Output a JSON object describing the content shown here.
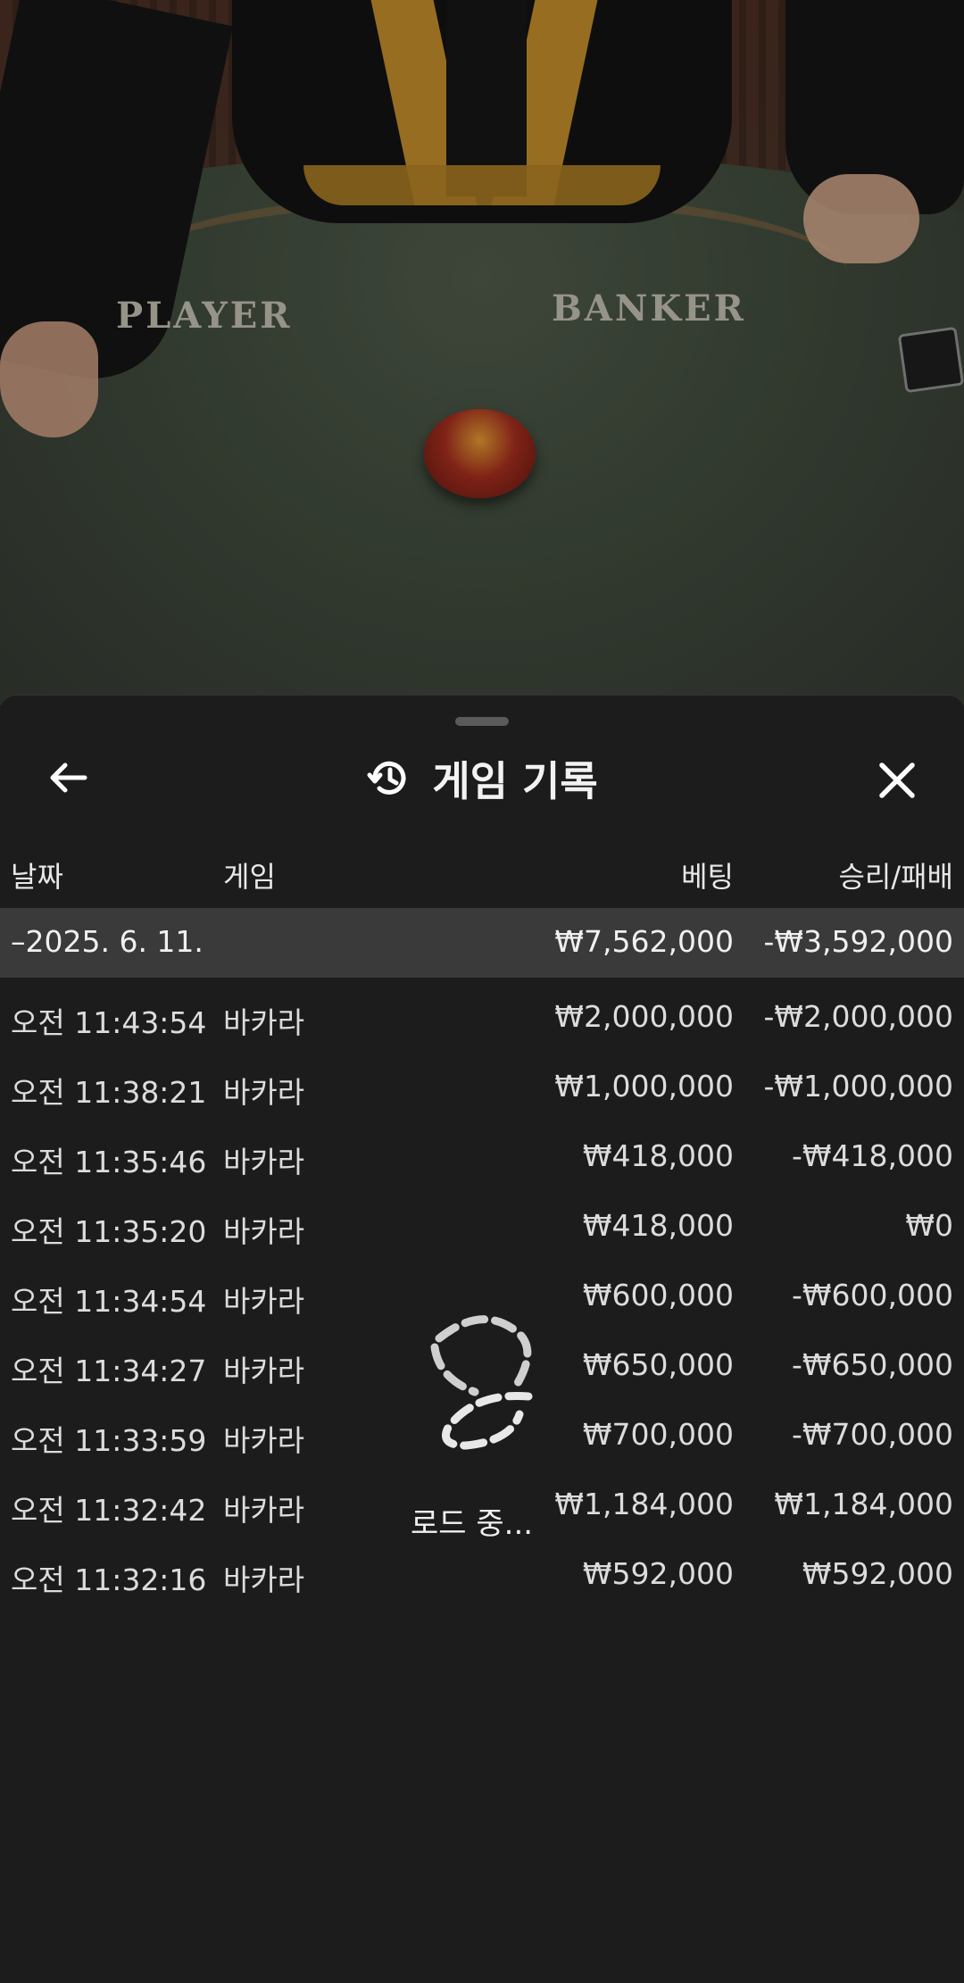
{
  "video": {
    "player_label": "PLAYER",
    "banker_label": "BANKER"
  },
  "header": {
    "title": "게임 기록",
    "history_icon": "history-icon",
    "back_icon": "arrow-left-icon",
    "close_icon": "close-icon"
  },
  "table": {
    "columns": {
      "date": "날짜",
      "game": "게임",
      "bet": "베팅",
      "result": "승리/패배"
    },
    "summary": {
      "date": "–2025. 6. 11.",
      "bet": "₩7,562,000",
      "result": "-₩3,592,000"
    },
    "rows": [
      {
        "time": "오전 11:43:54",
        "game": "바카라",
        "bet": "₩2,000,000",
        "result": "-₩2,000,000"
      },
      {
        "time": "오전 11:38:21",
        "game": "바카라",
        "bet": "₩1,000,000",
        "result": "-₩1,000,000"
      },
      {
        "time": "오전 11:35:46",
        "game": "바카라",
        "bet": "₩418,000",
        "result": "-₩418,000"
      },
      {
        "time": "오전 11:35:20",
        "game": "바카라",
        "bet": "₩418,000",
        "result": "₩0"
      },
      {
        "time": "오전 11:34:54",
        "game": "바카라",
        "bet": "₩600,000",
        "result": "-₩600,000"
      },
      {
        "time": "오전 11:34:27",
        "game": "바카라",
        "bet": "₩650,000",
        "result": "-₩650,000"
      },
      {
        "time": "오전 11:33:59",
        "game": "바카라",
        "bet": "₩700,000",
        "result": "-₩700,000"
      },
      {
        "time": "오전 11:32:42",
        "game": "바카라",
        "bet": "₩1,184,000",
        "result": "₩1,184,000"
      },
      {
        "time": "오전 11:32:16",
        "game": "바카라",
        "bet": "₩592,000",
        "result": "₩592,000"
      }
    ]
  },
  "loading": {
    "text": "로드 중...",
    "icon": "loading-spinner-icon"
  },
  "colors": {
    "sheet_bg": "#1c1c1c",
    "summary_bg": "#3a3a3a",
    "text": "#dcdcdc"
  }
}
